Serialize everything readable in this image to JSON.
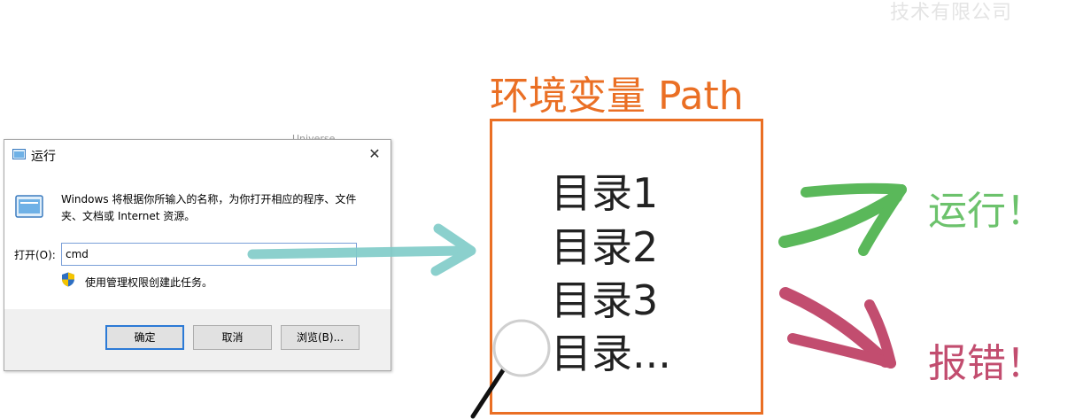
{
  "watermark": "技术有限公司",
  "background_text": "Universe",
  "run_dialog": {
    "title": "运行",
    "close_glyph": "✕",
    "description": "Windows 将根据你所输入的名称，为你打开相应的程序、文件夹、文档或 Internet 资源。",
    "open_label": "打开(O):",
    "input_value": "cmd",
    "admin_note": "使用管理权限创建此任务。",
    "buttons": {
      "ok": "确定",
      "cancel": "取消",
      "browse": "浏览(B)..."
    }
  },
  "path_panel": {
    "title": "环境变量 Path",
    "directories": [
      "目录1",
      "目录2",
      "目录3",
      "目录..."
    ]
  },
  "outcomes": {
    "success": "运行！",
    "error": "报错！"
  },
  "colors": {
    "accent_orange": "#ea6f24",
    "arrow_teal": "#7fcbc8",
    "success_green": "#6cc26c",
    "error_red": "#c24d6f"
  },
  "icons": [
    "run-app-icon",
    "close-icon",
    "shield-icon",
    "magnifier-icon",
    "arrow-right-icon"
  ]
}
